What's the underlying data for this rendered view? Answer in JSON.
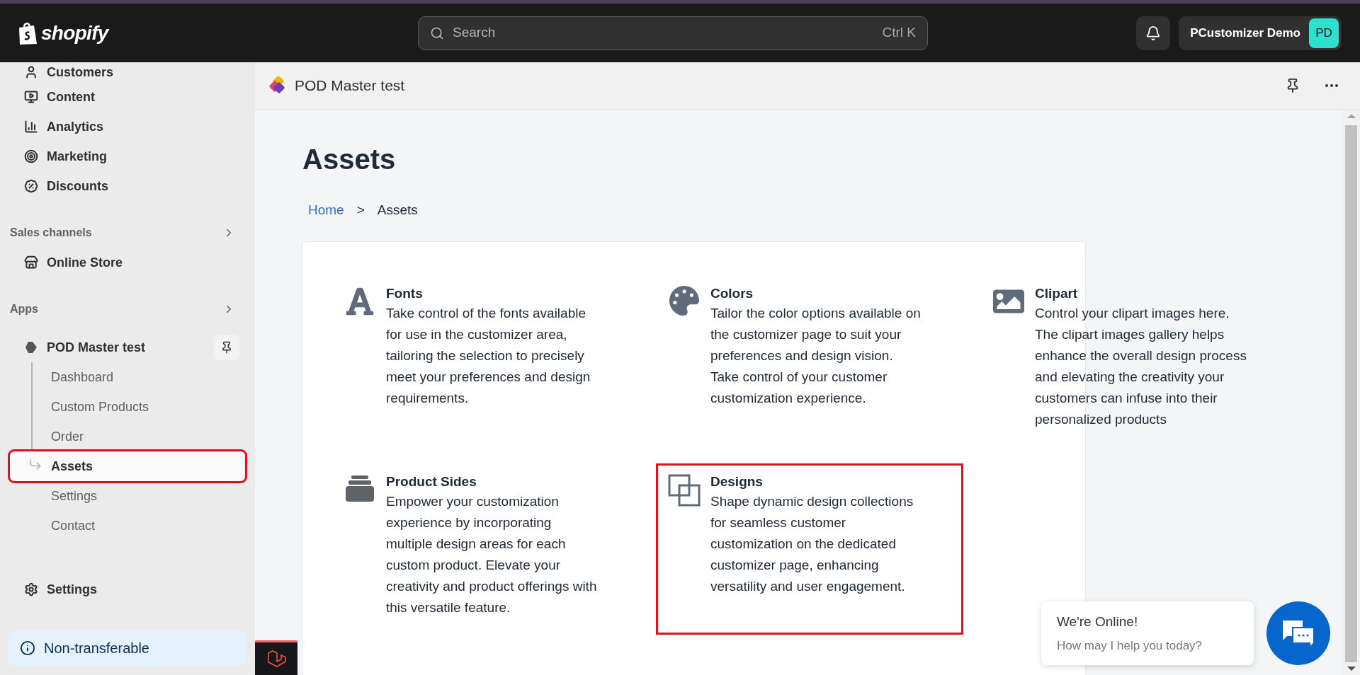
{
  "topbar": {
    "logo_text": "shopify",
    "search": {
      "placeholder": "Search",
      "shortcut": "Ctrl K"
    },
    "account": {
      "name": "PCustomizer Demo",
      "initials": "PD"
    }
  },
  "sidebar": {
    "top_items": [
      {
        "label": "Customers"
      },
      {
        "label": "Content"
      },
      {
        "label": "Analytics"
      },
      {
        "label": "Marketing"
      },
      {
        "label": "Discounts"
      }
    ],
    "sales_channels": {
      "heading": "Sales channels",
      "items": [
        {
          "label": "Online Store"
        }
      ]
    },
    "apps": {
      "heading": "Apps",
      "app": {
        "label": "POD Master test",
        "children": [
          {
            "label": "Dashboard",
            "selected": false,
            "highlighted": false
          },
          {
            "label": "Custom Products",
            "selected": false,
            "highlighted": false
          },
          {
            "label": "Order",
            "selected": false,
            "highlighted": false
          },
          {
            "label": "Assets",
            "selected": true,
            "highlighted": true
          },
          {
            "label": "Settings",
            "selected": false,
            "highlighted": false
          },
          {
            "label": "Contact",
            "selected": false,
            "highlighted": false
          }
        ]
      }
    },
    "bottom_items": [
      {
        "label": "Settings"
      }
    ],
    "notice": "Non-transferable"
  },
  "app_header": {
    "title": "POD Master test"
  },
  "page": {
    "title": "Assets",
    "breadcrumb": [
      {
        "label": "Home",
        "kind": "link"
      },
      {
        "label": ">",
        "kind": "separator"
      },
      {
        "label": "Assets",
        "kind": "current"
      }
    ]
  },
  "asset_cards": [
    {
      "title": "Fonts",
      "description": "Take control of the fonts available for use in the customizer area, tailoring the selection to precisely meet your preferences and design requirements.",
      "highlighted": false
    },
    {
      "title": "Colors",
      "description": "Tailor the color options available on the customizer page to suit your preferences and design vision. Take control of your customer customization experience.",
      "highlighted": false
    },
    {
      "title": "Clipart",
      "description": "Control your clipart images here. The clipart images gallery helps enhance the overall design process and elevating the creativity your customers can infuse into their personalized products",
      "highlighted": false
    },
    {
      "title": "Product Sides",
      "description": "Empower your customization experience by incorporating multiple design areas for each custom product. Elevate your creativity and product offerings with this versatile feature.",
      "highlighted": false
    },
    {
      "title": "Designs",
      "description": "Shape dynamic design collections for seamless customer customization on the dedicated customizer page, enhancing versatility and user engagement.",
      "highlighted": true
    }
  ],
  "chat": {
    "title": "We're Online!",
    "subtitle": "How may I help you today?"
  }
}
